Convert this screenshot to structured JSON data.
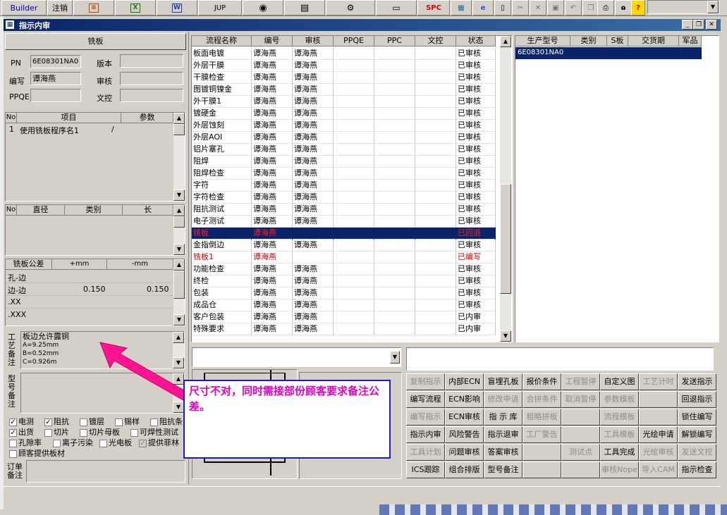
{
  "toolbar": {
    "builder": "Builder",
    "logout": "注销",
    "jup": "JUP",
    "spc": "SPC"
  },
  "window": {
    "title": "指示内审"
  },
  "mill": {
    "header": "铣板",
    "pn_label": "PN",
    "pn_value": "6E08301NA0",
    "version_label": "版本",
    "writer_label": "编写",
    "writer_value": "谭海燕",
    "audit_label": "审核",
    "ppqe_label": "PPQE",
    "doc_label": "文控"
  },
  "items_table": {
    "headers": [
      "No",
      "项目",
      "参数"
    ],
    "rows": [
      {
        "no": "1",
        "item": "使用铣板程序名1",
        "param": "/"
      }
    ]
  },
  "dia_table": {
    "headers": [
      "No",
      "直径",
      "类别",
      "长"
    ]
  },
  "tol_table": {
    "headers": [
      "铣板公差",
      "+mm",
      "-mm"
    ],
    "rows": [
      {
        "name": "孔-边",
        "plus": "",
        "minus": ""
      },
      {
        "name": "边-边",
        "plus": "0.150",
        "minus": "0.150"
      },
      {
        "name": ".XX",
        "plus": "",
        "minus": ""
      },
      {
        "name": ".XXX",
        "plus": "",
        "minus": ""
      }
    ]
  },
  "craft_note": {
    "label": "工艺备注",
    "lines": [
      "板边允许露铜",
      "A=9.25mm",
      "B=0.52mm",
      "C=0.926m"
    ]
  },
  "model_note_label": "型号备注",
  "checks": [
    {
      "label": "电测",
      "checked": true
    },
    {
      "label": "阻抗",
      "checked": true
    },
    {
      "label": "镀层",
      "checked": false
    },
    {
      "label": "锡样",
      "checked": false
    },
    {
      "label": "阻抗条",
      "checked": false
    },
    {
      "label": "出货",
      "checked": true
    },
    {
      "label": "切片",
      "checked": false
    },
    {
      "label": "切片母板",
      "checked": false
    },
    {
      "label": "可焊性测试",
      "checked": false
    },
    {
      "label": "孔隙率",
      "checked": false
    },
    {
      "label": "离子污染",
      "checked": false
    },
    {
      "label": "光电板",
      "checked": false
    },
    {
      "label": "提供菲林",
      "checked": true
    },
    {
      "label": "顾客提供板材",
      "checked": false
    }
  ],
  "order_note_label": "订单备注",
  "process_table": {
    "headers": [
      "流程名称",
      "编号",
      "审核",
      "PPQE",
      "PPC",
      "文控",
      "状态"
    ],
    "rows": [
      {
        "name": "板面电镀",
        "writer": "谭海燕",
        "audit": "谭海燕",
        "status": "已审核",
        "hl": false
      },
      {
        "name": "外层干膜",
        "writer": "谭海燕",
        "audit": "谭海燕",
        "status": "已审核",
        "hl": false
      },
      {
        "name": "干膜检查",
        "writer": "谭海燕",
        "audit": "谭海燕",
        "status": "已审核",
        "hl": false
      },
      {
        "name": "图镀铜镍金",
        "writer": "谭海燕",
        "audit": "谭海燕",
        "status": "已审核",
        "hl": false
      },
      {
        "name": "外干膜1",
        "writer": "谭海燕",
        "audit": "谭海燕",
        "status": "已审核",
        "hl": false
      },
      {
        "name": "镀硬金",
        "writer": "谭海燕",
        "audit": "谭海燕",
        "status": "已审核",
        "hl": false
      },
      {
        "name": "外层蚀刻",
        "writer": "谭海燕",
        "audit": "谭海燕",
        "status": "已审核",
        "hl": false
      },
      {
        "name": "外层AOI",
        "writer": "谭海燕",
        "audit": "谭海燕",
        "status": "已审核",
        "hl": false
      },
      {
        "name": "铝片塞孔",
        "writer": "谭海燕",
        "audit": "谭海燕",
        "status": "已审核",
        "hl": false
      },
      {
        "name": "阻焊",
        "writer": "谭海燕",
        "audit": "谭海燕",
        "status": "已审核",
        "hl": false
      },
      {
        "name": "阻焊检查",
        "writer": "谭海燕",
        "audit": "谭海燕",
        "status": "已审核",
        "hl": false
      },
      {
        "name": "字符",
        "writer": "谭海燕",
        "audit": "谭海燕",
        "status": "已审核",
        "hl": false
      },
      {
        "name": "字符检查",
        "writer": "谭海燕",
        "audit": "谭海燕",
        "status": "已审核",
        "hl": false
      },
      {
        "name": "阻抗测试",
        "writer": "谭海燕",
        "audit": "谭海燕",
        "status": "已审核",
        "hl": false
      },
      {
        "name": "电子测试",
        "writer": "谭海燕",
        "audit": "谭海燕",
        "status": "已审核",
        "hl": false
      },
      {
        "name": "铣板",
        "writer": "谭海燕",
        "audit": "",
        "status": "已回退",
        "hl": true
      },
      {
        "name": "金指倒边",
        "writer": "谭海燕",
        "audit": "谭海燕",
        "status": "已审核",
        "hl": false
      },
      {
        "name": "铣板1",
        "writer": "谭海燕",
        "audit": "",
        "status": "已编写",
        "hl": false,
        "red": true
      },
      {
        "name": "功能检查",
        "writer": "谭海燕",
        "audit": "谭海燕",
        "status": "已审核",
        "hl": false
      },
      {
        "name": "终检",
        "writer": "谭海燕",
        "audit": "谭海燕",
        "status": "已审核",
        "hl": false
      },
      {
        "name": "包装",
        "writer": "谭海燕",
        "audit": "谭海燕",
        "status": "已审核",
        "hl": false
      },
      {
        "name": "成品仓",
        "writer": "谭海燕",
        "audit": "谭海燕",
        "status": "已审核",
        "hl": false
      },
      {
        "name": "客户包装",
        "writer": "谭海燕",
        "audit": "谭海燕",
        "status": "已内审",
        "hl": false
      },
      {
        "name": "特殊要求",
        "writer": "谭海燕",
        "audit": "谭海燕",
        "status": "已内审",
        "hl": false
      }
    ]
  },
  "model_table": {
    "headers": [
      "生产型号",
      "类别",
      "S板",
      "交货期",
      "军品"
    ],
    "rows": [
      {
        "model": "6E08301NA0"
      }
    ]
  },
  "annotation": {
    "text": "尺寸不对，同时需接部份顾客要求备注公差。"
  },
  "buttons": [
    [
      "复制指示",
      "内部ECN",
      "盲埋孔板",
      "报价条件",
      "工程暂停",
      "自定义图",
      "工艺计时",
      "发送指示"
    ],
    [
      "编写流程",
      "ECN影响",
      "修改申请",
      "合拼条件",
      "取消暂停",
      "参数模板",
      "",
      "回退指示"
    ],
    [
      "编写指示",
      "ECN审核",
      "指 示 库",
      "粗略拼板",
      "",
      "流程模板",
      "",
      "锁住编写"
    ],
    [
      "指示内审",
      "风险警告",
      "指示退审",
      "工厂警告",
      "",
      "工具模板",
      "光绘申请",
      "解锁编写"
    ],
    [
      "工具计划",
      "问题审核",
      "答案审核",
      "",
      "测试点",
      "工具完成",
      "光绘审核",
      "发送文控"
    ],
    [
      "ICS跟踪",
      "组合排版",
      "型号备注",
      "",
      "",
      "审核Nope",
      "导入CAM",
      "指示检查"
    ]
  ],
  "disabled_buttons": [
    "复制指示",
    "工程暂停",
    "工艺计时",
    "修改申请",
    "合拼条件",
    "取消暂停",
    "参数模板",
    "编写指示",
    "粗略拼板",
    "流程模板",
    "工厂警告",
    "工具模板",
    "工具计划",
    "测试点",
    "光绘审核",
    "发送文控",
    "审核Nope",
    "导入CAM"
  ]
}
